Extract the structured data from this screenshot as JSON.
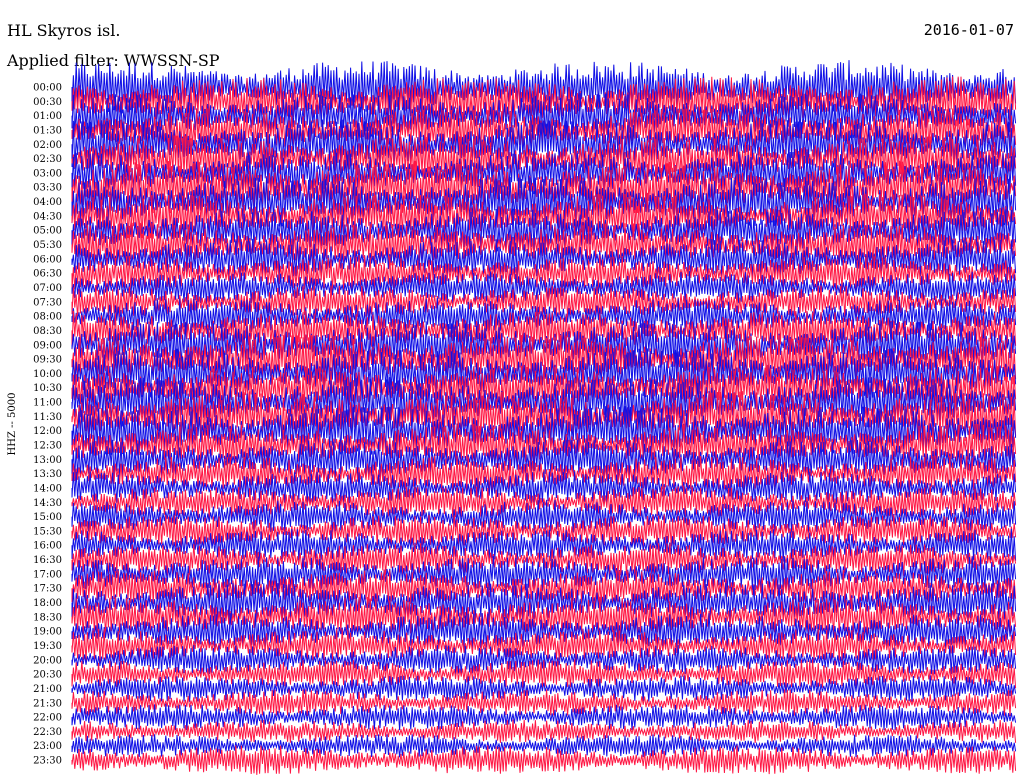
{
  "header": {
    "station": "HL Skyros isl.",
    "date": "2016-01-07",
    "filter": "Applied filter: WWSSN-SP"
  },
  "chart_data": {
    "type": "line",
    "title": "HL Skyros isl.",
    "date": "2016-01-07",
    "subtitle": "Applied filter: WWSSN-SP",
    "ylabel": "HHZ -- 5000",
    "xlabel": "",
    "grid": false,
    "trace_colors": [
      "#1010e6",
      "#ff1744"
    ],
    "rows": [
      "00:00",
      "00:30",
      "01:00",
      "01:30",
      "02:00",
      "02:30",
      "03:00",
      "03:30",
      "04:00",
      "04:30",
      "05:00",
      "05:30",
      "06:00",
      "06:30",
      "07:00",
      "07:30",
      "08:00",
      "08:30",
      "09:00",
      "09:30",
      "10:00",
      "10:30",
      "11:00",
      "11:30",
      "12:00",
      "12:30",
      "13:00",
      "13:30",
      "14:00",
      "14:30",
      "15:00",
      "15:30",
      "16:00",
      "16:30",
      "17:00",
      "17:30",
      "18:00",
      "18:30",
      "19:00",
      "19:30",
      "20:00",
      "20:30",
      "21:00",
      "21:30",
      "22:00",
      "22:30",
      "23:00",
      "23:30"
    ],
    "row_amplitude": [
      1.6,
      1.5,
      1.4,
      1.3,
      1.5,
      1.4,
      1.3,
      1.6,
      1.5,
      1.4,
      1.3,
      1.3,
      1.2,
      1.1,
      1.0,
      1.0,
      1.1,
      1.2,
      1.4,
      1.5,
      1.5,
      1.4,
      1.5,
      1.5,
      1.5,
      1.3,
      1.2,
      1.1,
      1.0,
      1.0,
      1.0,
      1.0,
      1.0,
      1.0,
      1.1,
      1.1,
      1.2,
      1.2,
      1.1,
      1.0,
      0.9,
      0.9,
      0.8,
      0.8,
      0.8,
      0.7,
      0.7,
      0.9
    ]
  }
}
